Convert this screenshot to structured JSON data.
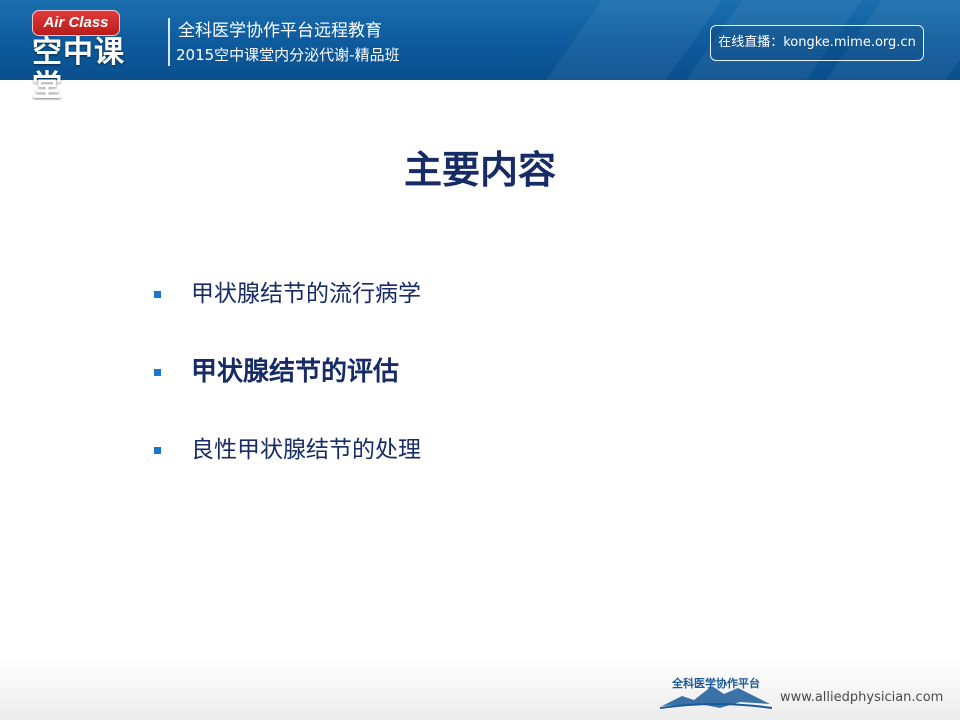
{
  "header": {
    "logo_badge": "Air Class",
    "logo_cn": "空中课堂",
    "platform_title": "全科医学协作平台远程教育",
    "course_title": "2015空中课堂内分泌代谢-精品班",
    "live_label": "在线直播：kongke.mime.org.cn"
  },
  "slide": {
    "title": "主要内容",
    "bullets": [
      {
        "text": "甲状腺结节的流行病学",
        "bold": false
      },
      {
        "text": "甲状腺结节的评估",
        "bold": true
      },
      {
        "text": "良性甲状腺结节的处理",
        "bold": false
      }
    ]
  },
  "footer": {
    "logo_text": "全科医学协作平台",
    "url": "www.alliedphysician.com"
  },
  "colors": {
    "header_blue": "#0d5a9c",
    "title_navy": "#172b66",
    "bullet_blue": "#1b78c6"
  }
}
